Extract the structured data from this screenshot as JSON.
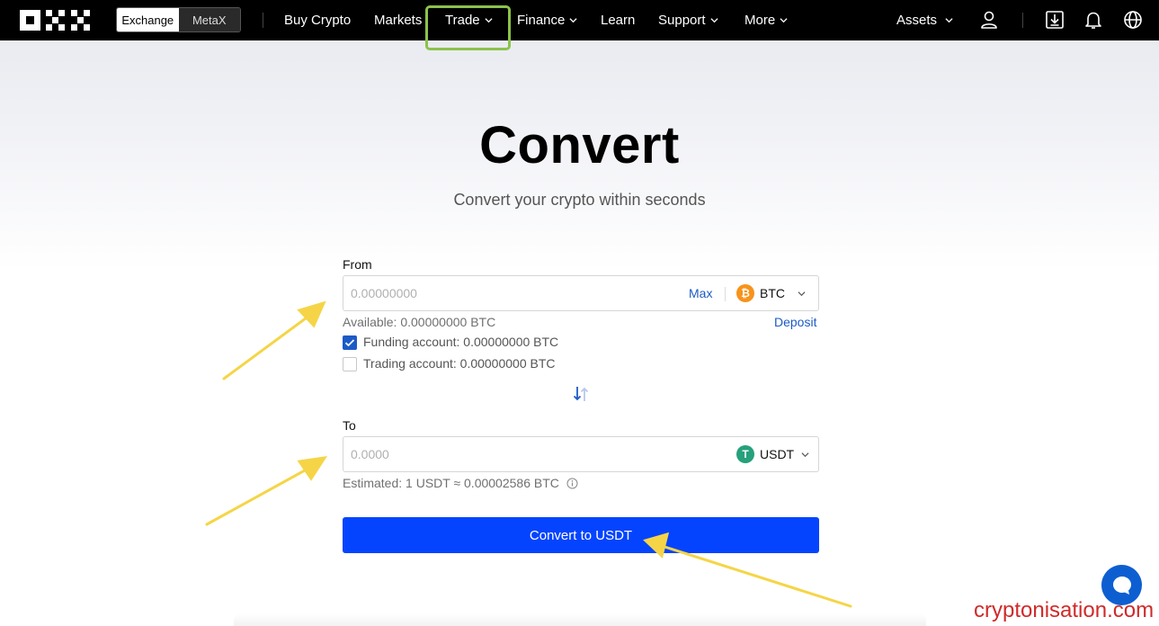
{
  "nav": {
    "toggle": [
      "Exchange",
      "MetaX"
    ],
    "items": {
      "buy_crypto": "Buy Crypto",
      "markets": "Markets",
      "trade": "Trade",
      "finance": "Finance",
      "learn": "Learn",
      "support": "Support",
      "more": "More"
    },
    "assets": "Assets",
    "icons": [
      "user-icon",
      "download-icon",
      "bell-icon",
      "globe-icon"
    ]
  },
  "hero": {
    "title": "Convert",
    "subtitle": "Convert your crypto within seconds"
  },
  "from": {
    "label": "From",
    "placeholder": "0.00000000",
    "max": "Max",
    "coin": "BTC",
    "coin_symbol": "₿",
    "available": "Available: 0.00000000 BTC",
    "deposit": "Deposit",
    "funding": "Funding account: 0.00000000 BTC",
    "funding_checked": true,
    "trading": "Trading account: 0.00000000 BTC",
    "trading_checked": false
  },
  "to": {
    "label": "To",
    "placeholder": "0.0000",
    "coin": "USDT",
    "coin_symbol": "T",
    "estimated": "Estimated: 1 USDT ≈ 0.00002586 BTC"
  },
  "action": {
    "convert": "Convert to USDT"
  },
  "watermark": "cryptonisation.com",
  "colors": {
    "accent": "#0544ff",
    "link": "#1c5ac6",
    "btc": "#f7931a",
    "usdt": "#26a17b",
    "highlight": "#8bc34a",
    "arrow": "#f5d547"
  }
}
